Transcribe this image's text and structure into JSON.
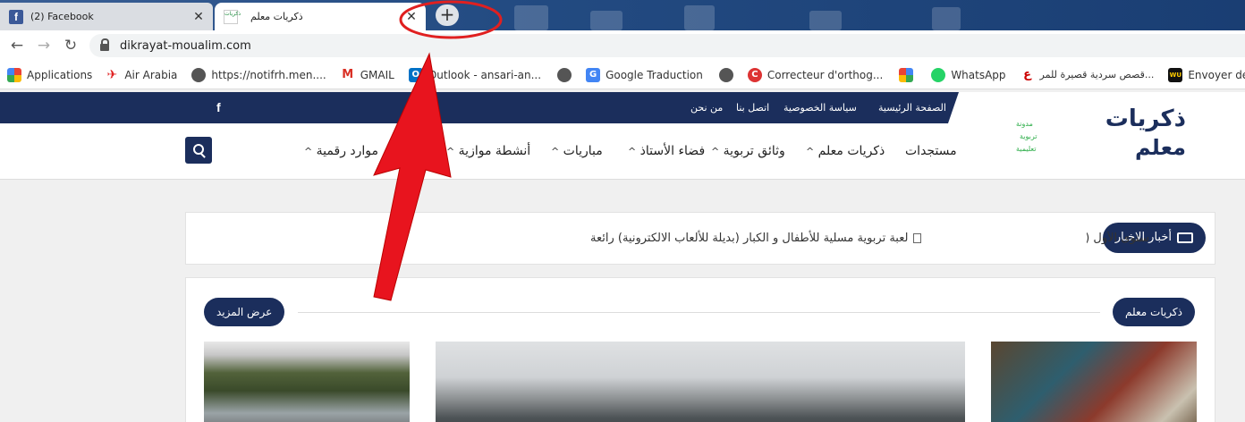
{
  "browser": {
    "tabs": [
      {
        "title": "(2) Facebook",
        "favicon": "facebook-icon",
        "close": "✕"
      },
      {
        "title": "ذكريات معلم",
        "favicon": "site-favicon",
        "close": "✕"
      }
    ],
    "new_tab_label": "+",
    "url": "dikrayat-moualim.com",
    "back": "←",
    "forward": "→",
    "reload": "↻"
  },
  "bookmarks": [
    {
      "label": "Applications",
      "icon": "apps-grid-icon"
    },
    {
      "label": "Air Arabia",
      "icon": "airplane-icon"
    },
    {
      "label": "https://notifrh.men....",
      "icon": "globe-icon"
    },
    {
      "label": "GMAIL",
      "icon": "gmail-icon"
    },
    {
      "label": "Outlook - ansari-an...",
      "icon": "outlook-icon"
    },
    {
      "label": "",
      "icon": "globe-icon"
    },
    {
      "label": "Google Traduction",
      "icon": "google-translate-icon"
    },
    {
      "label": "",
      "icon": "globe-icon"
    },
    {
      "label": "Correcteur d'orthog...",
      "icon": "reverso-icon"
    },
    {
      "label": "",
      "icon": "google-icon"
    },
    {
      "label": "WhatsApp",
      "icon": "whatsapp-icon"
    },
    {
      "label": "قصص سردية قصيرة للمر...",
      "icon": "arabic-site-icon"
    },
    {
      "label": "Envoyer de l'argent...",
      "icon": "wu-icon"
    }
  ],
  "site": {
    "top_links": [
      "الصفحة الرئيسية",
      "سياسة الخصوصية",
      "اتصل بنا",
      "من نحن"
    ],
    "facebook_glyph": "f",
    "logo": {
      "main": "ذكريات",
      "second": "معلم",
      "tag1": "مدونة",
      "tag2": "تربوية",
      "tag3": "تعليمية"
    },
    "menu": [
      {
        "label": "مستجدات"
      },
      {
        "label": "ذكريات معلم"
      },
      {
        "label": "وثائق تربوية"
      },
      {
        "label": "فضاء الأستاذ"
      },
      {
        "label": "مباريات"
      },
      {
        "label": "أنشطة موازية"
      },
      {
        "label": "موارد رقمية"
      }
    ],
    "caret": "^",
    "news": {
      "label": "أخبار الاخبار",
      "items": [
        "لعبة تربوية مسلية للأطفال و الكبار (بديلة للألعاب الالكترونية) رائعة",
        "ستوى الأول (CP) نموذجا"
      ]
    },
    "section": {
      "title": "ذكريات معلم",
      "more": "عرض المزيد"
    }
  },
  "colors": {
    "brand": "#1b2e5c",
    "accent_green": "#2eae4a",
    "annotation": "#e02020"
  }
}
